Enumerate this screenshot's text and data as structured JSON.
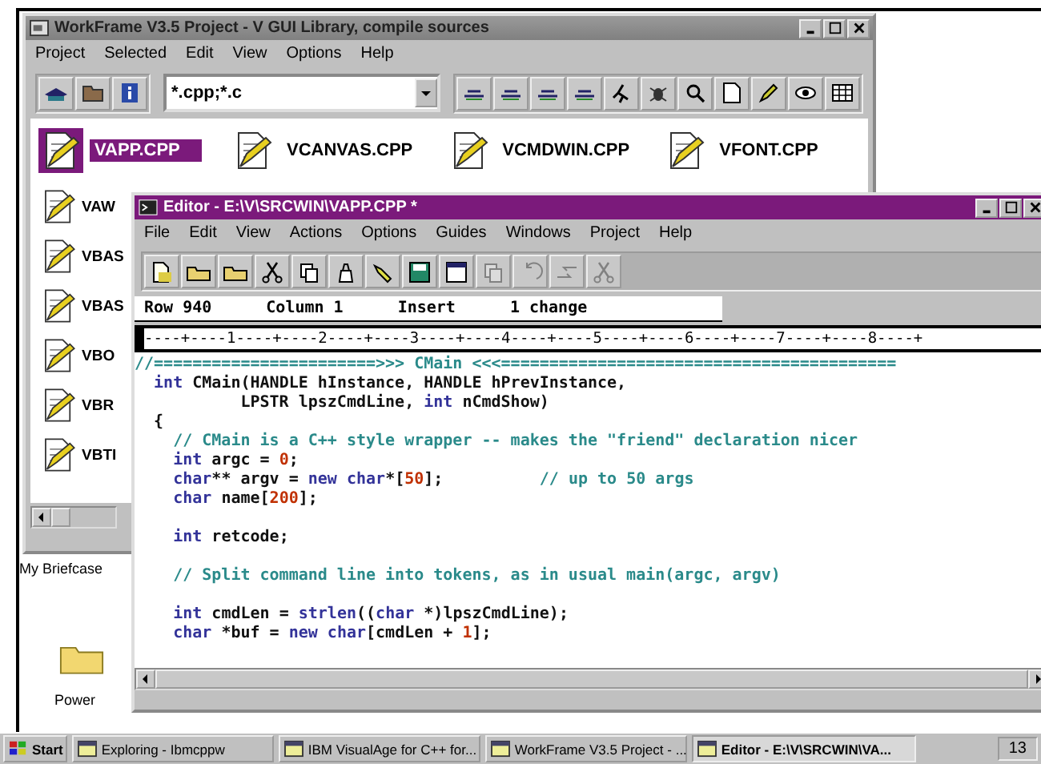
{
  "workframe": {
    "title": "WorkFrame V3.5 Project - V GUI Library, compile sources",
    "menu": [
      "Project",
      "Selected",
      "Edit",
      "View",
      "Options",
      "Help"
    ],
    "filter": {
      "value": "*.cpp;*.c"
    },
    "files_row": [
      {
        "name": "VAPP.CPP",
        "selected": true
      },
      {
        "name": "VCANVAS.CPP",
        "selected": false
      },
      {
        "name": "VCMDWIN.CPP",
        "selected": false
      },
      {
        "name": "VFONT.CPP",
        "selected": false
      }
    ],
    "files_column": [
      {
        "name": "VAW",
        "selected": false
      },
      {
        "name": "VBAS",
        "selected": false
      },
      {
        "name": "VBAS",
        "selected": false
      },
      {
        "name": "VBO",
        "selected": false
      },
      {
        "name": "VBR",
        "selected": false
      },
      {
        "name": "VBTI",
        "selected": false
      }
    ]
  },
  "desktop_icons": [
    {
      "label": "My Briefcase",
      "kind": "hidden"
    },
    {
      "label": "Power",
      "kind": "folder"
    }
  ],
  "editor": {
    "title": "Editor - E:\\V\\SRCWIN\\VAPP.CPP  *",
    "menu": [
      "File",
      "Edit",
      "View",
      "Actions",
      "Options",
      "Guides",
      "Windows",
      "Project",
      "Help"
    ],
    "toolbar": [
      {
        "kind": "new",
        "disabled": false
      },
      {
        "kind": "open",
        "disabled": false
      },
      {
        "kind": "open",
        "disabled": false
      },
      {
        "kind": "cut",
        "disabled": false
      },
      {
        "kind": "copy",
        "disabled": false
      },
      {
        "kind": "paste",
        "disabled": false
      },
      {
        "kind": "mark",
        "disabled": false
      },
      {
        "kind": "save",
        "disabled": false
      },
      {
        "kind": "window",
        "disabled": false
      },
      {
        "kind": "copy",
        "disabled": true
      },
      {
        "kind": "undo",
        "disabled": true
      },
      {
        "kind": "redo",
        "disabled": true
      },
      {
        "kind": "cut",
        "disabled": true
      }
    ],
    "status": [
      "Row 940",
      "Column 1",
      "Insert",
      "1 change"
    ],
    "ruler": "----+----1----+----2----+----3----+----4----+----5----+----6----+----7----+----8----+",
    "code": [
      {
        "kind": "code",
        "tokens": [
          {
            "kind": "comment",
            "text": "//=======================>>> CMain <<<========================================="
          }
        ]
      },
      {
        "kind": "code",
        "tokens": [
          {
            "kind": "kw",
            "text": "  int"
          },
          {
            "kind": "plain",
            "text": " CMain(HANDLE hInstance, HANDLE hPrevInstance,"
          }
        ]
      },
      {
        "kind": "code",
        "tokens": [
          {
            "kind": "plain",
            "text": "           LPSTR lpszCmdLine, "
          },
          {
            "kind": "kw",
            "text": "int"
          },
          {
            "kind": "plain",
            "text": " nCmdShow)"
          }
        ]
      },
      {
        "kind": "code",
        "tokens": [
          {
            "kind": "plain",
            "text": "  {"
          }
        ]
      },
      {
        "kind": "code",
        "tokens": [
          {
            "kind": "comment",
            "text": "    // CMain is a C++ style wrapper -- makes the \"friend\" declaration nicer"
          }
        ]
      },
      {
        "kind": "code",
        "tokens": [
          {
            "kind": "kw",
            "text": "    int"
          },
          {
            "kind": "plain",
            "text": " argc = "
          },
          {
            "kind": "num",
            "text": "0"
          },
          {
            "kind": "plain",
            "text": ";"
          }
        ]
      },
      {
        "kind": "code",
        "tokens": [
          {
            "kind": "kw",
            "text": "    char"
          },
          {
            "kind": "plain",
            "text": "** argv = "
          },
          {
            "kind": "kw",
            "text": "new char"
          },
          {
            "kind": "plain",
            "text": "*["
          },
          {
            "kind": "num",
            "text": "50"
          },
          {
            "kind": "plain",
            "text": "];"
          },
          {
            "kind": "comment",
            "text": "          // up to 50 args"
          }
        ]
      },
      {
        "kind": "code",
        "tokens": [
          {
            "kind": "kw",
            "text": "    char"
          },
          {
            "kind": "plain",
            "text": " name["
          },
          {
            "kind": "num",
            "text": "200"
          },
          {
            "kind": "plain",
            "text": "];"
          }
        ]
      },
      {
        "kind": "blank"
      },
      {
        "kind": "code",
        "tokens": [
          {
            "kind": "kw",
            "text": "    int"
          },
          {
            "kind": "plain",
            "text": " retcode;"
          }
        ]
      },
      {
        "kind": "blank"
      },
      {
        "kind": "code",
        "tokens": [
          {
            "kind": "comment",
            "text": "    // Split command line into tokens, as in usual main(argc, argv)"
          }
        ]
      },
      {
        "kind": "blank"
      },
      {
        "kind": "code",
        "tokens": [
          {
            "kind": "kw",
            "text": "    int"
          },
          {
            "kind": "plain",
            "text": " cmdLen = "
          },
          {
            "kind": "kw",
            "text": "strlen"
          },
          {
            "kind": "plain",
            "text": "(("
          },
          {
            "kind": "kw",
            "text": "char"
          },
          {
            "kind": "plain",
            "text": " *)lpszCmdLine);"
          }
        ]
      },
      {
        "kind": "code",
        "tokens": [
          {
            "kind": "kw",
            "text": "    char"
          },
          {
            "kind": "plain",
            "text": " *buf = "
          },
          {
            "kind": "kw",
            "text": "new char"
          },
          {
            "kind": "plain",
            "text": "[cmdLen + "
          },
          {
            "kind": "num",
            "text": "1"
          },
          {
            "kind": "plain",
            "text": "];"
          }
        ]
      }
    ]
  },
  "taskbar": {
    "start": "Start",
    "tasks": [
      {
        "label": "Exploring - Ibmcppw",
        "selected": false
      },
      {
        "label": "IBM VisualAge for C++ for...",
        "selected": false
      },
      {
        "label": "WorkFrame V3.5 Project - ...",
        "selected": false
      },
      {
        "label": "Editor - E:\\V\\SRCWIN\\VA...",
        "selected": true
      }
    ],
    "clock": "13"
  }
}
